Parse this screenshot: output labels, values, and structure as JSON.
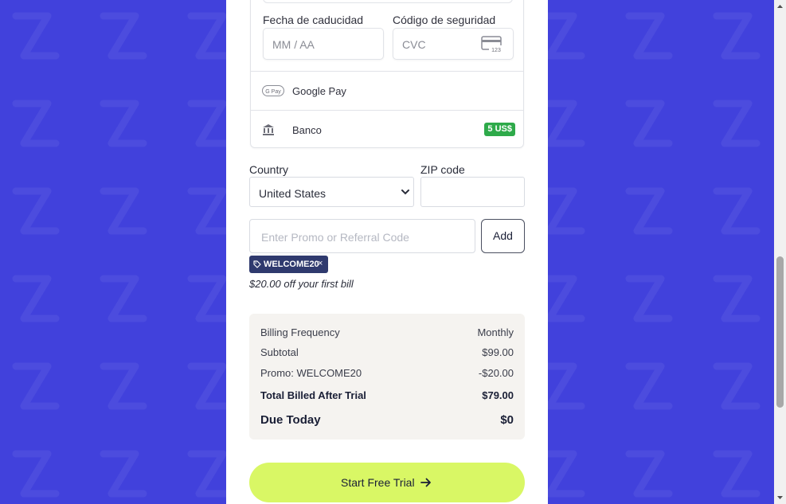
{
  "payment": {
    "expiry_label": "Fecha de caducidad",
    "expiry_placeholder": "MM / AA",
    "cvc_label": "Código de seguridad",
    "cvc_placeholder": "CVC",
    "cvc_icon_text": "123",
    "methods": [
      {
        "label": "Google Pay",
        "icon": "google-pay-icon"
      },
      {
        "label": "Banco",
        "icon": "bank-icon",
        "badge": "5 US$"
      }
    ]
  },
  "address": {
    "country_label": "Country",
    "country_value": "United States",
    "zip_label": "ZIP code"
  },
  "promo": {
    "placeholder": "Enter Promo or Referral Code",
    "add_label": "Add",
    "applied_code": "WELCOME20",
    "remove_symbol": "×",
    "note": "$20.00 off your first bill"
  },
  "summary": {
    "rows": [
      {
        "label": "Billing Frequency",
        "value": "Monthly"
      },
      {
        "label": "Subtotal",
        "value": "$99.00"
      },
      {
        "label": "Promo: WELCOME20",
        "value": "-$20.00"
      },
      {
        "label": "Total Billed After Trial",
        "value": "$79.00"
      }
    ],
    "due_label": "Due Today",
    "due_value": "$0"
  },
  "cta": {
    "label": "Start Free Trial"
  },
  "colors": {
    "page_bg": "#4141dc",
    "cta_bg": "#d9f765",
    "badge_green": "#2eaa4a",
    "chip_bg": "#2f3a6e"
  }
}
